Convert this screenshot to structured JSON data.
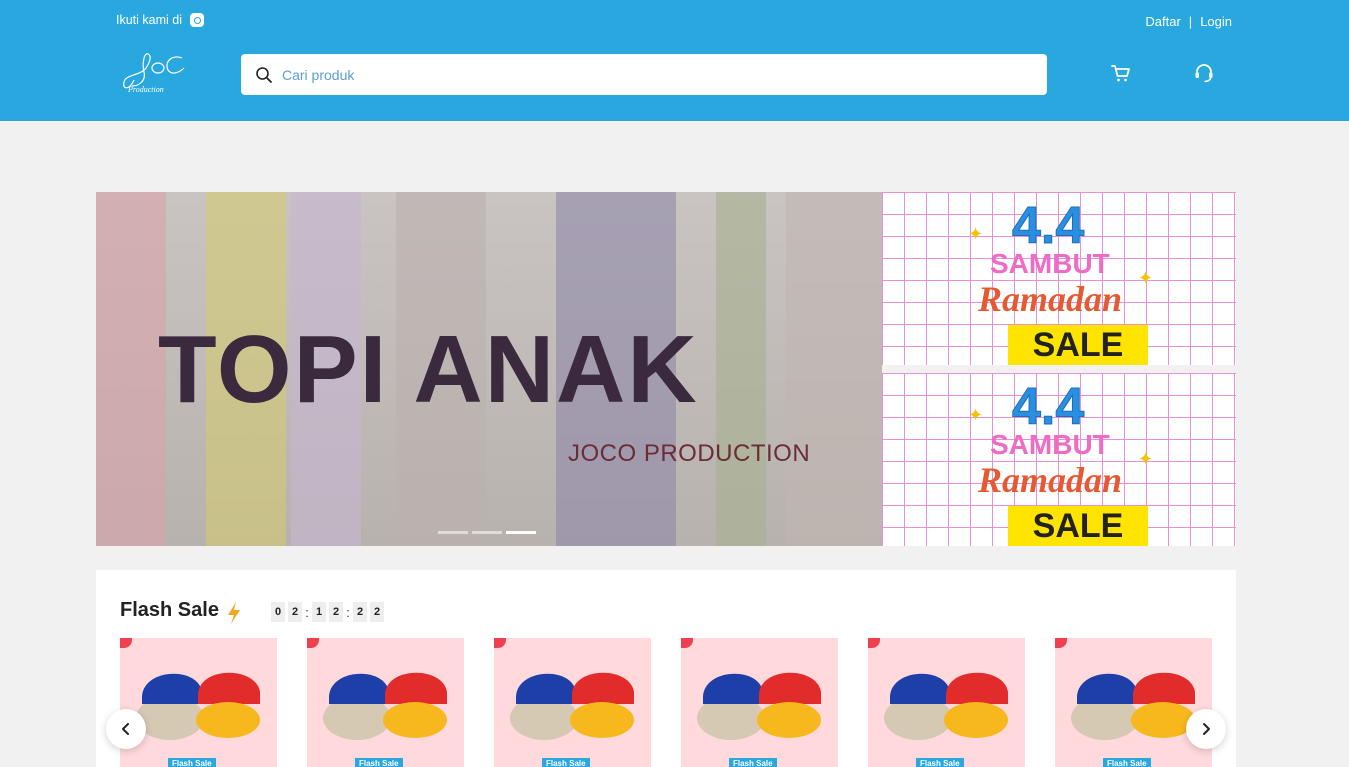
{
  "header": {
    "follow_text": "Ikuti kami di",
    "register_label": "Daftar",
    "separator": "|",
    "login_label": "Login",
    "logo_text": "Production",
    "search": {
      "placeholder": "Cari produk"
    },
    "colors": {
      "brand": "#29a8e0"
    }
  },
  "banner": {
    "title": "TOPI ANAK",
    "subtitle": "JOCO PRODUCTION",
    "dots_count": 3,
    "active_dot": 3
  },
  "promos": [
    {
      "big": "4.4",
      "line1": "SAMBUT",
      "line2": "Ramadan",
      "line3": "SALE"
    },
    {
      "big": "4.4",
      "line1": "SAMBUT",
      "line2": "Ramadan",
      "line3": "SALE"
    }
  ],
  "flash_sale": {
    "title": "Flash Sale",
    "timer": [
      "0",
      "2",
      "1",
      "2",
      "2",
      "2"
    ],
    "product_tag": "Flash Sale",
    "product_count": 6
  }
}
